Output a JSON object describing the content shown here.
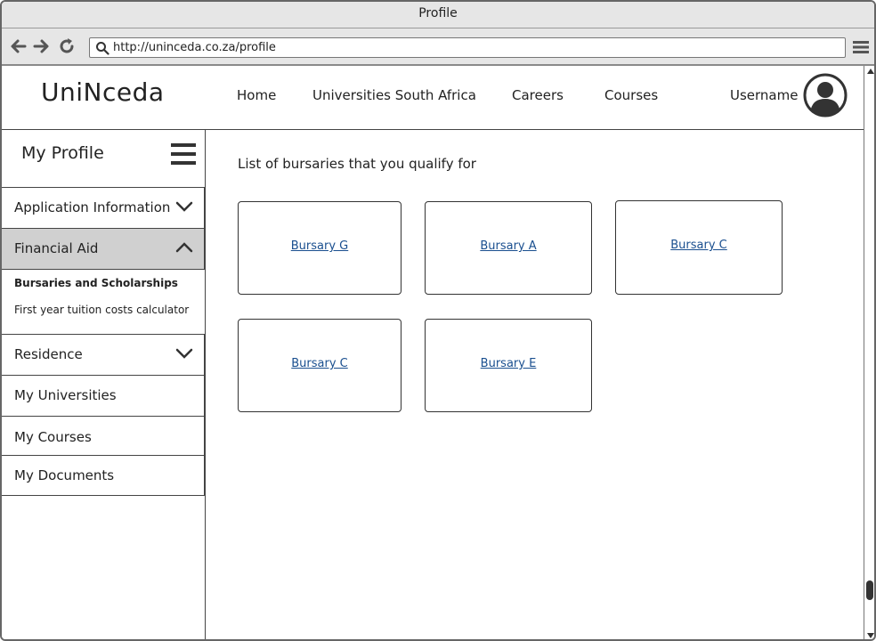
{
  "window": {
    "title": "Profile"
  },
  "browser": {
    "url": "http://uninceda.co.za/profile",
    "back_icon": "arrow-left-icon",
    "forward_icon": "arrow-right-icon",
    "reload_icon": "reload-icon",
    "menu_icon": "hamburger-menu-icon"
  },
  "header": {
    "logo": "UniNceda",
    "nav": [
      "Home",
      "Universities South Africa",
      "Careers",
      "Courses"
    ],
    "username": "Username",
    "avatar_icon": "user-avatar-icon"
  },
  "sidebar": {
    "title": "My Profile",
    "items": [
      {
        "label": "Application Information",
        "state": "collapsed"
      },
      {
        "label": "Financial Aid",
        "state": "expanded",
        "sub_items": [
          "Bursaries and Scholarships",
          "First year tuition costs calculator"
        ],
        "active_sub_item": "Bursaries and Scholarships"
      },
      {
        "label": "Residence",
        "state": "collapsed"
      },
      {
        "label": "My Universities"
      },
      {
        "label": "My Courses"
      },
      {
        "label": "My Documents"
      }
    ]
  },
  "main": {
    "title": "List of bursaries that you qualify for",
    "bursaries": [
      "Bursary G",
      "Bursary A",
      "Bursary C",
      "Bursary C",
      "Bursary E"
    ]
  },
  "colors": {
    "link": "#1a4f8f",
    "expanded_bg": "#d0d0d0",
    "chrome_bg": "#e6e6e6"
  }
}
